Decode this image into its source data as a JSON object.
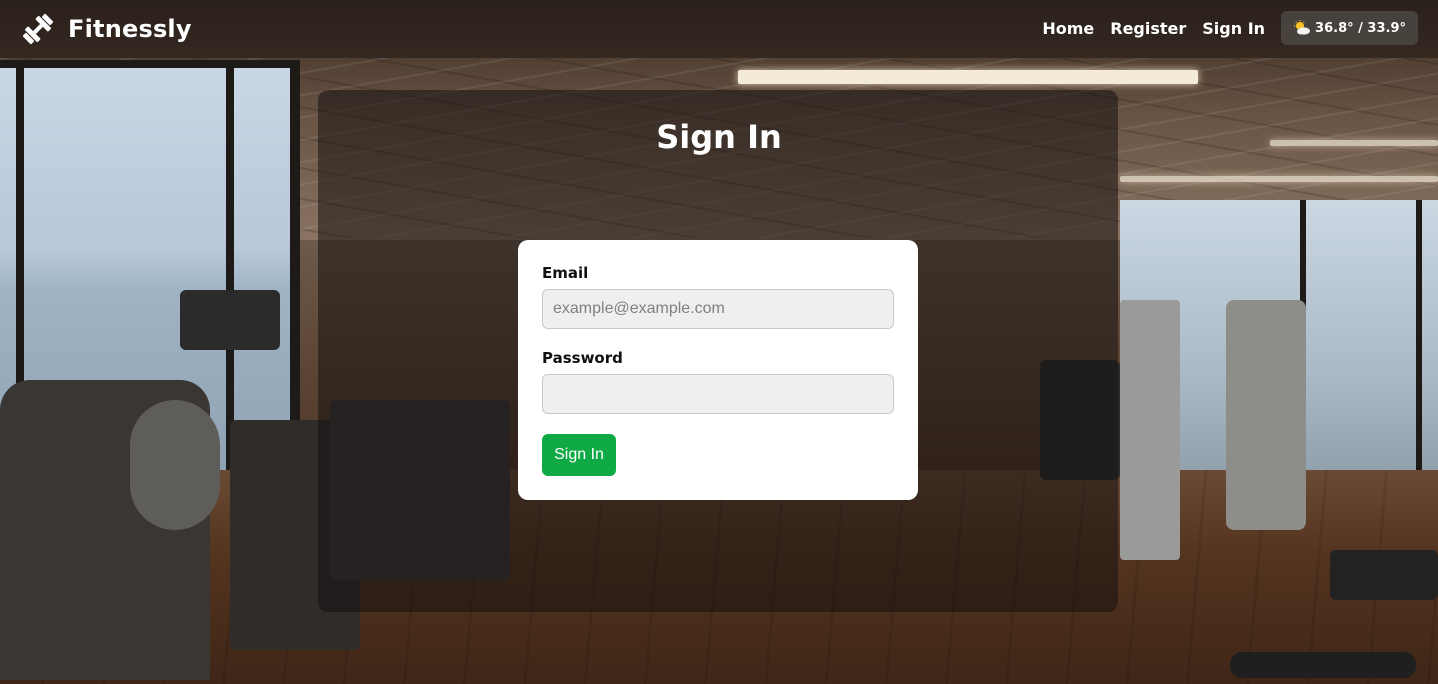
{
  "brand": {
    "name": "Fitnessly",
    "icon": "dumbbell-icon"
  },
  "nav": {
    "items": [
      {
        "label": "Home"
      },
      {
        "label": "Register"
      },
      {
        "label": "Sign In"
      }
    ],
    "weather": {
      "icon": "partly-sunny-icon",
      "text": "36.8° / 33.9°"
    }
  },
  "page": {
    "title": "Sign In"
  },
  "form": {
    "email_label": "Email",
    "email_placeholder": "example@example.com",
    "email_value": "",
    "password_label": "Password",
    "password_value": "",
    "submit_label": "Sign In"
  },
  "colors": {
    "accent": "#0fa945",
    "card": "#ffffff",
    "input_bg": "#efefef"
  }
}
